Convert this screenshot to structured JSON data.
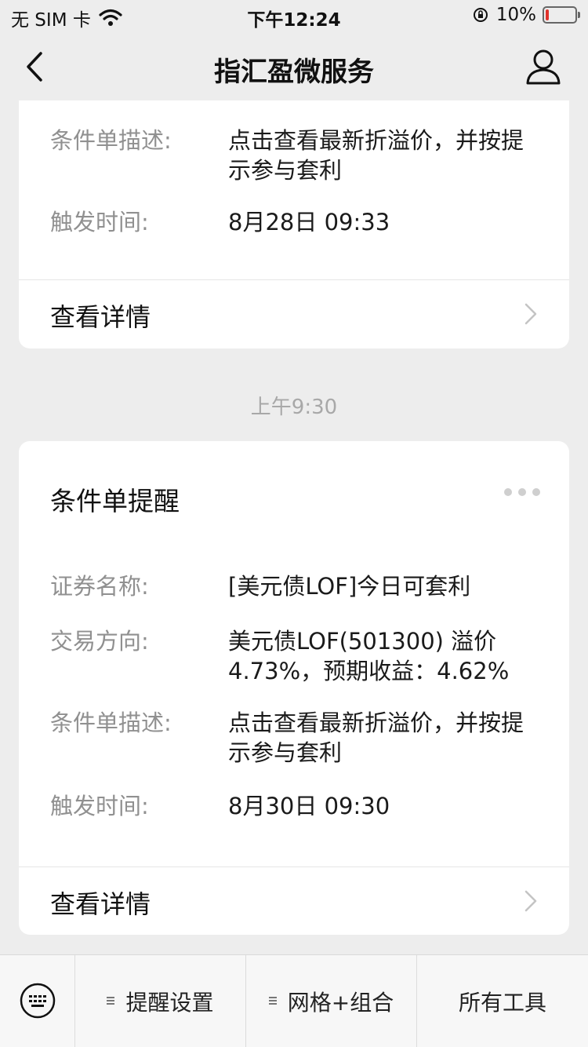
{
  "status_bar": {
    "carrier": "无 SIM 卡",
    "time": "下午12:24",
    "battery_percent": "10%",
    "battery_level": 0.1
  },
  "nav": {
    "title": "指汇盈微服务"
  },
  "card_prev": {
    "rows": [
      {
        "label": "条件单描述:",
        "value": "点击查看最新折溢价，并按提示参与套利"
      },
      {
        "label": "触发时间:",
        "value": "8月28日 09:33"
      }
    ],
    "detail_label": "查看详情"
  },
  "time_separator": "上午9:30",
  "card_main": {
    "title": "条件单提醒",
    "rows": [
      {
        "label": "证券名称:",
        "value": "[美元债LOF]今日可套利"
      },
      {
        "label": "交易方向:",
        "value": "美元债LOF(501300) 溢价4.73%，预期收益：4.62%"
      },
      {
        "label": "条件单描述:",
        "value": "点击查看最新折溢价，并按提示参与套利"
      },
      {
        "label": "触发时间:",
        "value": "8月30日 09:30"
      }
    ],
    "detail_label": "查看详情"
  },
  "bottom_menu": {
    "items": [
      {
        "label": "提醒设置"
      },
      {
        "label": "网格+组合"
      },
      {
        "label": "所有工具"
      }
    ]
  }
}
